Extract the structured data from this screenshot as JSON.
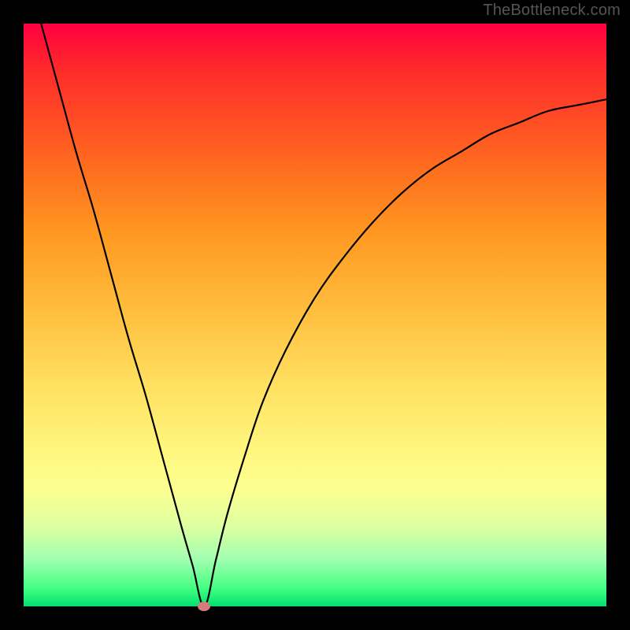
{
  "watermark": "TheBottleneck.com",
  "chart_data": {
    "type": "line",
    "title": "",
    "xlabel": "",
    "ylabel": "",
    "xlim": [
      0,
      100
    ],
    "ylim": [
      0,
      100
    ],
    "optimum_x": 31,
    "optimum_y": 0,
    "marker": {
      "x": 31,
      "y": 0,
      "color": "#d77a7a"
    },
    "series": [
      {
        "name": "bottleneck-curve",
        "x": [
          3,
          6,
          9,
          12,
          15,
          18,
          21,
          24,
          27,
          29,
          31,
          33,
          35,
          38,
          41,
          45,
          50,
          55,
          60,
          65,
          70,
          75,
          80,
          85,
          90,
          95,
          100
        ],
        "y": [
          100,
          89,
          78,
          68,
          57,
          46,
          36,
          25,
          14,
          7,
          0,
          8,
          16,
          26,
          35,
          44,
          53,
          60,
          66,
          71,
          75,
          78,
          81,
          83,
          85,
          86,
          87
        ]
      }
    ],
    "background_gradient": {
      "top": "#ff0040",
      "mid": "#ffe060",
      "bottom": "#00e070"
    }
  }
}
